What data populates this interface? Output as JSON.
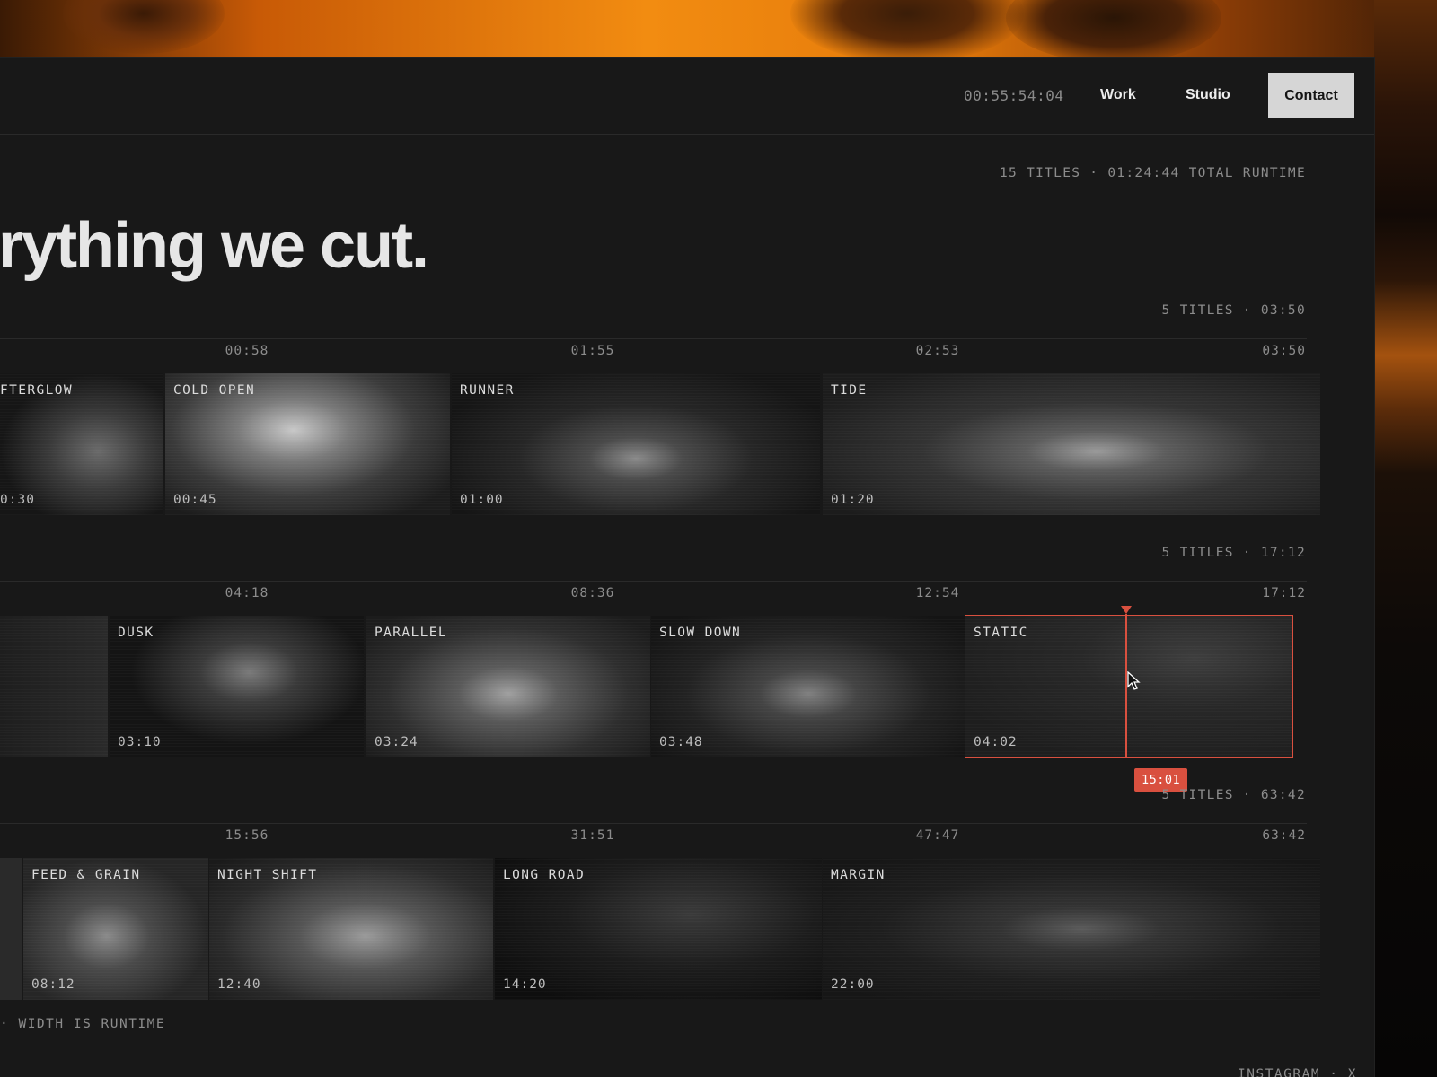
{
  "header": {
    "timecode": "00:55:54:04",
    "nav": {
      "work": "Work",
      "studio": "Studio",
      "contact": "Contact"
    }
  },
  "summary": "15 TITLES · 01:24:44 TOTAL RUNTIME",
  "headline": "rything we cut.",
  "rows": [
    {
      "meta": "5 TITLES · 03:50",
      "ticks": [
        "00:58",
        "01:55",
        "02:53",
        "03:50"
      ],
      "clips": [
        {
          "title": "FTERGLOW",
          "duration": "0:30"
        },
        {
          "title": "COLD OPEN",
          "duration": "00:45"
        },
        {
          "title": "RUNNER",
          "duration": "01:00"
        },
        {
          "title": "TIDE",
          "duration": "01:20"
        }
      ]
    },
    {
      "meta": "5 TITLES · 17:12",
      "ticks": [
        "04:18",
        "08:36",
        "12:54",
        "17:12"
      ],
      "clips": [
        {
          "title": "",
          "duration": ""
        },
        {
          "title": "DUSK",
          "duration": "03:10"
        },
        {
          "title": "PARALLEL",
          "duration": "03:24"
        },
        {
          "title": "SLOW DOWN",
          "duration": "03:48"
        },
        {
          "title": "STATIC",
          "duration": "04:02",
          "selected": true
        }
      ]
    },
    {
      "meta": "5 TITLES · 63:42",
      "ticks": [
        "15:56",
        "31:51",
        "47:47",
        "63:42"
      ],
      "clips": [
        {
          "title": "",
          "duration": ""
        },
        {
          "title": "FEED & GRAIN",
          "duration": "08:12"
        },
        {
          "title": "NIGHT SHIFT",
          "duration": "12:40"
        },
        {
          "title": "LONG ROAD",
          "duration": "14:20"
        },
        {
          "title": "MARGIN",
          "duration": "22:00"
        }
      ]
    }
  ],
  "playhead": {
    "time": "15:01"
  },
  "footer": {
    "left": "· WIDTH IS RUNTIME",
    "right": "INSTAGRAM · X"
  },
  "colors": {
    "accent": "#d9503f",
    "panel": "#181818",
    "sunset": "#f28c11"
  }
}
